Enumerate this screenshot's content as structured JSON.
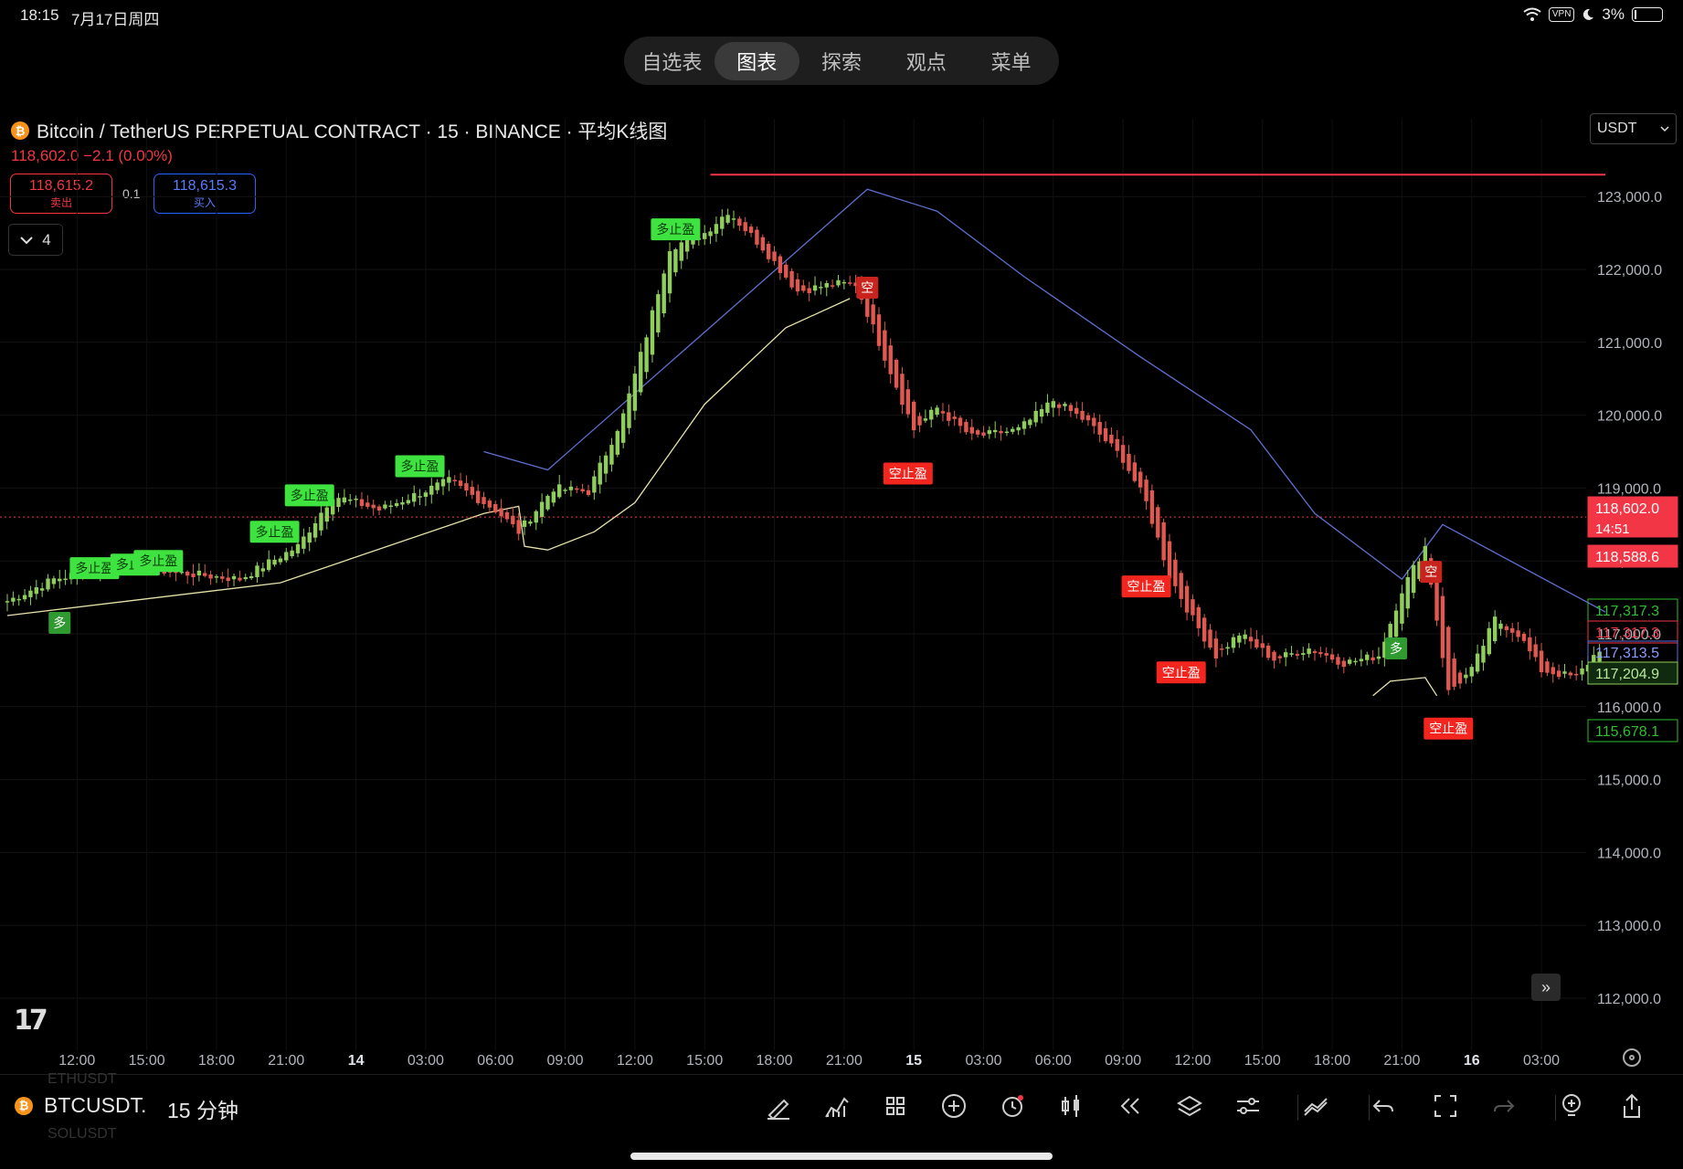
{
  "status_bar": {
    "time": "18:15",
    "date": "7月17日周四",
    "vpn": "VPN",
    "battery": "3%"
  },
  "nav": {
    "tabs": [
      {
        "label": "自选表",
        "active": false
      },
      {
        "label": "图表",
        "active": true
      },
      {
        "label": "探索",
        "active": false
      },
      {
        "label": "观点",
        "active": false
      },
      {
        "label": "菜单",
        "active": false
      }
    ]
  },
  "header": {
    "title": "Bitcoin / TetherUS PERPETUAL CONTRACT · 15 · BINANCE · 平均K线图",
    "coin_icon": "bitcoin-icon",
    "price_line": "118,602.0  −2.1 (0.00%)",
    "sell_price": "118,615.2",
    "sell_label": "卖出",
    "spread": "0.1",
    "buy_price": "118,615.3",
    "buy_label": "买入",
    "indicator_count": "4",
    "currency": "USDT"
  },
  "colors": {
    "up": "#8fce5a",
    "down": "#e0584f",
    "upbox": "#3fe33f",
    "downbox": "#f2251f",
    "blue": "#5f6fd0",
    "yellow": "#e6e3a8",
    "red": "#f23645"
  },
  "chart_data": {
    "type": "candlestick",
    "title": "Bitcoin / TetherUS PERPETUAL CONTRACT · 15 · BINANCE · 平均K线图",
    "ylim": [
      111300,
      123900
    ],
    "yticks": [
      112000,
      113000,
      114000,
      115000,
      116000,
      117000,
      118000,
      119000,
      120000,
      121000,
      122000,
      123000
    ],
    "ytick_labels": [
      "112,000.0",
      "113,000.0",
      "114,000.0",
      "115,000.0",
      "116,000.0",
      "117,000.0",
      "118,000.0",
      "119,000.0",
      "120,000.0",
      "121,000.0",
      "122,000.0",
      "123,000.0"
    ],
    "xticks": [
      {
        "label": "12:00",
        "bar": 12
      },
      {
        "label": "15:00",
        "bar": 24
      },
      {
        "label": "18:00",
        "bar": 36
      },
      {
        "label": "21:00",
        "bar": 48
      },
      {
        "label": "14",
        "bar": 60
      },
      {
        "label": "03:00",
        "bar": 72
      },
      {
        "label": "06:00",
        "bar": 84
      },
      {
        "label": "09:00",
        "bar": 96
      },
      {
        "label": "12:00",
        "bar": 108
      },
      {
        "label": "15:00",
        "bar": 120
      },
      {
        "label": "18:00",
        "bar": 132
      },
      {
        "label": "21:00",
        "bar": 144
      },
      {
        "label": "15",
        "bar": 156
      },
      {
        "label": "03:00",
        "bar": 168
      },
      {
        "label": "06:00",
        "bar": 180
      },
      {
        "label": "09:00",
        "bar": 192
      },
      {
        "label": "12:00",
        "bar": 204
      },
      {
        "label": "15:00",
        "bar": 216
      },
      {
        "label": "18:00",
        "bar": 228
      },
      {
        "label": "21:00",
        "bar": 240
      },
      {
        "label": "16",
        "bar": 252
      },
      {
        "label": "03:00",
        "bar": 264
      }
    ],
    "bar_count": 275,
    "close_anchors": [
      [
        0,
        117450
      ],
      [
        8,
        117750
      ],
      [
        20,
        117950
      ],
      [
        28,
        117850
      ],
      [
        40,
        117750
      ],
      [
        50,
        118200
      ],
      [
        56,
        118900
      ],
      [
        64,
        118700
      ],
      [
        76,
        119100
      ],
      [
        84,
        118700
      ],
      [
        88,
        118400
      ],
      [
        94,
        119000
      ],
      [
        100,
        118950
      ],
      [
        106,
        120000
      ],
      [
        110,
        121100
      ],
      [
        114,
        122300
      ],
      [
        120,
        122500
      ],
      [
        124,
        122800
      ],
      [
        130,
        122300
      ],
      [
        136,
        121700
      ],
      [
        142,
        121800
      ],
      [
        146,
        121800
      ],
      [
        150,
        121000
      ],
      [
        156,
        119800
      ],
      [
        160,
        120100
      ],
      [
        166,
        119700
      ],
      [
        174,
        119800
      ],
      [
        180,
        120200
      ],
      [
        186,
        119900
      ],
      [
        192,
        119400
      ],
      [
        196,
        118800
      ],
      [
        200,
        117800
      ],
      [
        204,
        117200
      ],
      [
        208,
        116700
      ],
      [
        212,
        117000
      ],
      [
        218,
        116650
      ],
      [
        224,
        116800
      ],
      [
        230,
        116600
      ],
      [
        236,
        116700
      ],
      [
        240,
        117600
      ],
      [
        244,
        118200
      ],
      [
        248,
        116200
      ],
      [
        252,
        116500
      ],
      [
        256,
        117200
      ],
      [
        260,
        117000
      ],
      [
        264,
        116500
      ],
      [
        270,
        116400
      ],
      [
        274,
        116800
      ]
    ],
    "last_price": 118602.0,
    "price_labels": [
      {
        "value": 118602.0,
        "text": "118,602.0",
        "sub": "14:51",
        "style": "red-fill"
      },
      {
        "value": 118588.6,
        "text": "118,588.6",
        "style": "red-fill"
      },
      {
        "value": 117317.3,
        "text": "117,317.3",
        "style": "green-outline"
      },
      {
        "value": 117317.3,
        "text": "117,317.3",
        "style": "red-outline"
      },
      {
        "value": 117313.5,
        "text": "117,313.5",
        "style": "blue-outline"
      },
      {
        "value": 117204.9,
        "text": "117,204.9",
        "style": "green-fill-outline"
      },
      {
        "value": 115678.1,
        "text": "115,678.1",
        "style": "green-outline"
      }
    ],
    "resistance_line": {
      "value": 123300,
      "from_bar": 121,
      "to_bar": 275
    },
    "lower_line": [
      [
        0,
        117250
      ],
      [
        47,
        117700
      ],
      [
        82,
        118650
      ],
      [
        88,
        118750
      ],
      [
        89,
        118200
      ],
      [
        93,
        118150
      ],
      [
        101,
        118400
      ],
      [
        108,
        118800
      ],
      [
        120,
        120150
      ],
      [
        134,
        121200
      ],
      [
        145,
        121600
      ]
    ],
    "lower_line2": [
      [
        235,
        116150
      ],
      [
        238,
        116350
      ],
      [
        244,
        116400
      ],
      [
        246,
        116150
      ]
    ],
    "upper_line": [
      [
        82,
        119500
      ],
      [
        93,
        119250
      ],
      [
        148,
        123100
      ],
      [
        160,
        122800
      ],
      [
        175,
        121900
      ],
      [
        195,
        120800
      ],
      [
        214,
        119800
      ],
      [
        225,
        118650
      ],
      [
        240,
        117750
      ],
      [
        247,
        118500
      ],
      [
        275,
        117300
      ]
    ],
    "signals": [
      {
        "text": "多",
        "bar": 9,
        "value": 117150,
        "type": "long"
      },
      {
        "text": "多止盈",
        "bar": 15,
        "value": 117900,
        "type": "long-tp"
      },
      {
        "text": "多止盈",
        "bar": 22,
        "value": 117950,
        "type": "long-tp"
      },
      {
        "text": "多止盈",
        "bar": 26,
        "value": 118000,
        "type": "long-tp"
      },
      {
        "text": "多止盈",
        "bar": 46,
        "value": 118400,
        "type": "long-tp"
      },
      {
        "text": "多止盈",
        "bar": 52,
        "value": 118900,
        "type": "long-tp"
      },
      {
        "text": "多止盈",
        "bar": 71,
        "value": 119300,
        "type": "long-tp"
      },
      {
        "text": "多止盈",
        "bar": 115,
        "value": 122550,
        "type": "long-tp"
      },
      {
        "text": "空",
        "bar": 148,
        "value": 121750,
        "type": "short"
      },
      {
        "text": "空止盈",
        "bar": 155,
        "value": 119200,
        "type": "short-tp"
      },
      {
        "text": "空止盈",
        "bar": 196,
        "value": 117650,
        "type": "short-tp"
      },
      {
        "text": "空止盈",
        "bar": 202,
        "value": 116470,
        "type": "short-tp"
      },
      {
        "text": "多",
        "bar": 239,
        "value": 116800,
        "type": "long"
      },
      {
        "text": "空",
        "bar": 245,
        "value": 117850,
        "type": "short"
      },
      {
        "text": "空止盈",
        "bar": 248,
        "value": 115700,
        "type": "short-tp"
      }
    ]
  },
  "bottom_toolbar": {
    "symbol": "BTCUSDT.",
    "interval": "15 分钟",
    "ghost_top": "ETHUSDT",
    "ghost_bottom": "SOLUSDT",
    "tools": [
      "drawing-pen-icon",
      "indicators-icon",
      "layouts-grid-icon",
      "add-circle-icon",
      "alert-clock-icon",
      "candle-type-icon",
      "replay-icon",
      "layers-icon",
      "settings-sliders-icon",
      "trend-icon",
      "undo-icon",
      "fullscreen-icon",
      "redo-icon",
      "idea-icon",
      "share-icon"
    ]
  }
}
